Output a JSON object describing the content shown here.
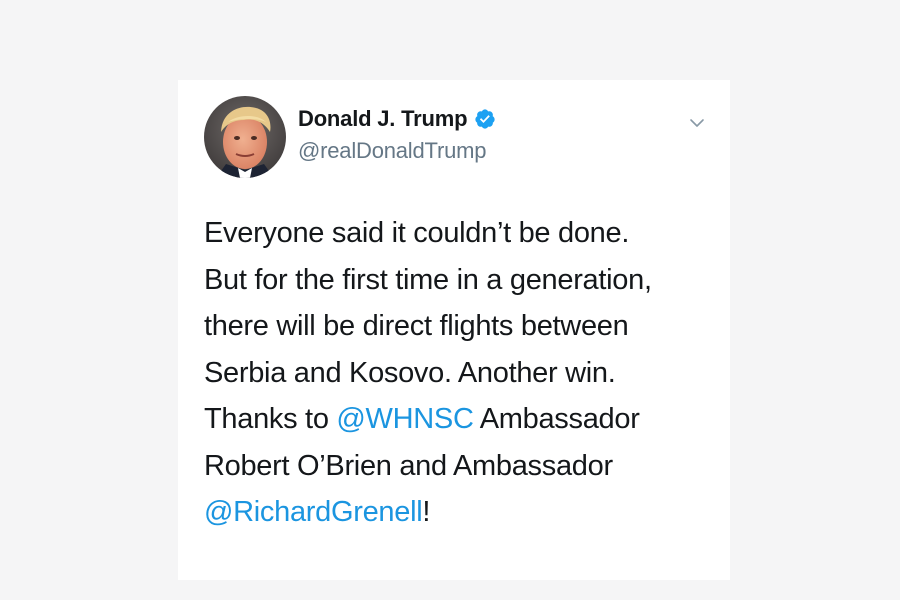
{
  "tweet": {
    "author": {
      "display_name": "Donald J. Trump",
      "handle": "@realDonaldTrump",
      "verified": true
    },
    "icons": {
      "avatar": "profile-photo",
      "verified": "verified-badge-icon",
      "menu": "chevron-down-icon"
    },
    "colors": {
      "link": "#1b95e0",
      "text": "#14171a",
      "handle": "#657786",
      "verified": "#1da1f2"
    },
    "text_lines": [
      {
        "parts": [
          {
            "text": "Everyone said it couldn’t be done."
          }
        ]
      },
      {
        "parts": [
          {
            "text": "But for the first time in a generation,"
          }
        ]
      },
      {
        "parts": [
          {
            "text": "there will be direct flights between"
          }
        ]
      },
      {
        "parts": [
          {
            "text": "Serbia and Kosovo. Another win."
          }
        ]
      },
      {
        "parts": [
          {
            "text": "Thanks to "
          },
          {
            "text": "@WHNSC",
            "mention": true
          },
          {
            "text": " Ambassador"
          }
        ]
      },
      {
        "parts": [
          {
            "text": "Robert O’Brien and Ambassador"
          }
        ]
      },
      {
        "parts": [
          {
            "text": "@RichardGrenell",
            "mention": true
          },
          {
            "text": "!"
          }
        ]
      }
    ]
  }
}
